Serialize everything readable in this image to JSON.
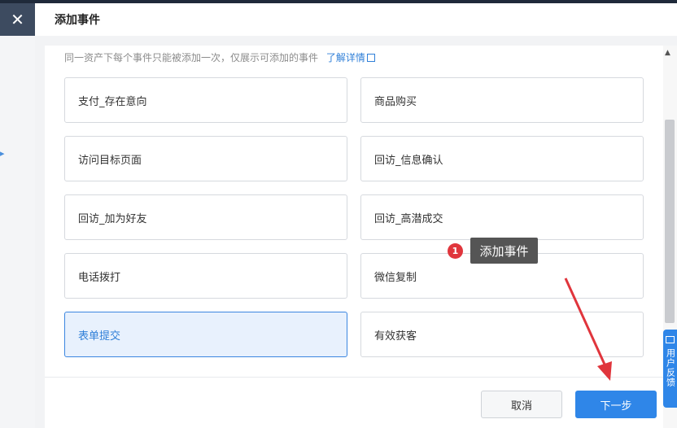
{
  "header": {
    "title": "添加事件"
  },
  "hint": {
    "text": "同一资产下每个事件只能被添加一次，仅展示可添加的事件",
    "link": "了解详情"
  },
  "options": [
    {
      "label": "支付_存在意向",
      "selected": false
    },
    {
      "label": "商品购买",
      "selected": false
    },
    {
      "label": "访问目标页面",
      "selected": false
    },
    {
      "label": "回访_信息确认",
      "selected": false
    },
    {
      "label": "回访_加为好友",
      "selected": false
    },
    {
      "label": "回访_高潜成交",
      "selected": false
    },
    {
      "label": "电话拨打",
      "selected": false
    },
    {
      "label": "微信复制",
      "selected": false
    },
    {
      "label": "表单提交",
      "selected": true
    },
    {
      "label": "有效获客",
      "selected": false
    }
  ],
  "buttons": {
    "cancel": "取消",
    "next": "下一步"
  },
  "feedback": {
    "label": "用户反馈"
  },
  "tooltip": {
    "badge": "1",
    "text": "添加事件"
  },
  "colors": {
    "primary": "#2f86e8",
    "selected_bg": "#e8f1fd",
    "badge": "#e0353c",
    "arrow": "#e0353c"
  },
  "icons": {
    "close": "close-icon",
    "external": "external-link-icon",
    "feedback": "feedback-icon"
  }
}
